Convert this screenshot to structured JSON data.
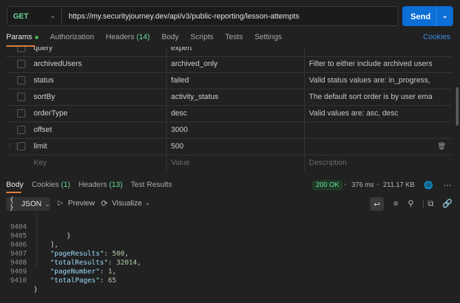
{
  "request": {
    "method": "GET",
    "url": "https://my.securityjourney.dev/api/v3/public-reporting/lesson-attempts",
    "send_label": "Send"
  },
  "request_tabs": {
    "params": "Params",
    "authorization": "Authorization",
    "headers": "Headers",
    "headers_count": "(14)",
    "body": "Body",
    "scripts": "Scripts",
    "tests": "Tests",
    "settings": "Settings",
    "cookies": "Cookies"
  },
  "params": [
    {
      "key": "query",
      "value": "expert",
      "description": ""
    },
    {
      "key": "archivedUsers",
      "value": "archived_only",
      "description": "Filter to either include archived users, e..."
    },
    {
      "key": "status",
      "value": "failed",
      "description": "Valid status values are: in_progress, sub..."
    },
    {
      "key": "sortBy",
      "value": "activity_status",
      "description": "The default sort order is by user email in ..."
    },
    {
      "key": "orderType",
      "value": "desc",
      "description": "Valid values are: asc, desc"
    },
    {
      "key": "offset",
      "value": "3000",
      "description": ""
    },
    {
      "key": "limit",
      "value": "500",
      "description": ""
    }
  ],
  "params_placeholder": {
    "key": "Key",
    "value": "Value",
    "description": "Description"
  },
  "response_tabs": {
    "body": "Body",
    "cookies": "Cookies",
    "cookies_count": "(1)",
    "headers": "Headers",
    "headers_count": "(13)",
    "test_results": "Test Results"
  },
  "response_meta": {
    "status": "200 OK",
    "time": "376 ms",
    "size": "211.17 KB"
  },
  "response_toolbar": {
    "format": "JSON",
    "preview": "Preview",
    "visualize": "Visualize"
  },
  "code_lines": [
    {
      "n": "9404",
      "text": "        }"
    },
    {
      "n": "9405",
      "text": "    ],"
    },
    {
      "n": "9406",
      "key": "\"pageResults\"",
      "val": "500",
      "tail": ","
    },
    {
      "n": "9407",
      "key": "\"totalResults\"",
      "val": "32014",
      "tail": ","
    },
    {
      "n": "9408",
      "key": "\"pageNumber\"",
      "val": "1",
      "tail": ","
    },
    {
      "n": "9409",
      "key": "\"totalPages\"",
      "val": "65",
      "tail": ""
    },
    {
      "n": "9410",
      "text": "}"
    }
  ],
  "colors": {
    "accent_send": "#0b6fd6",
    "method_get": "#6bdd9a",
    "active_tab_underline": "#e8823a",
    "status_ok": "#6bdd9a"
  }
}
